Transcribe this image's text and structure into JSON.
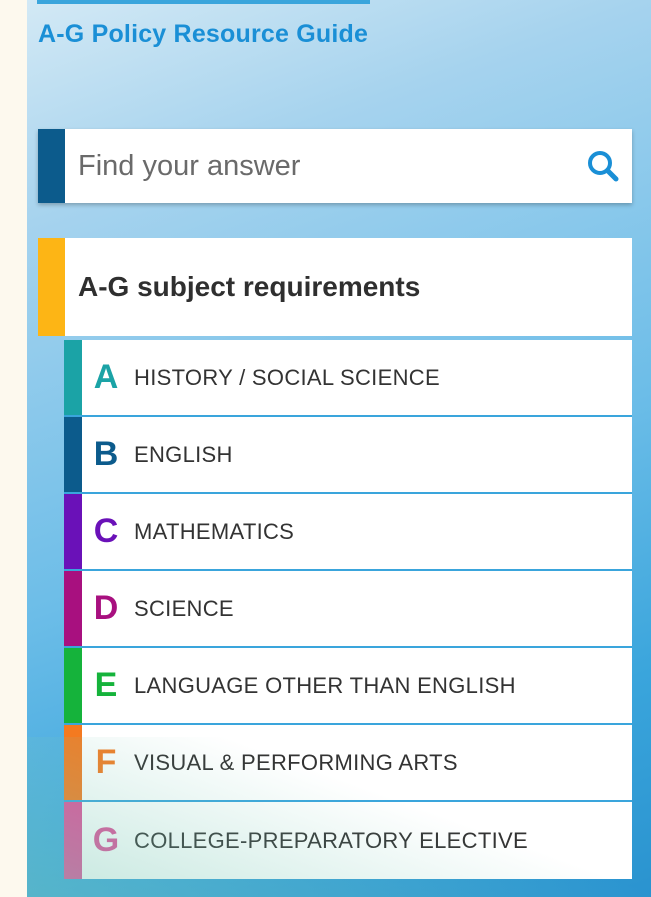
{
  "sidebar": {
    "title": "A-G Policy Resource Guide",
    "search": {
      "placeholder": "Find your answer",
      "value": "",
      "icon": "search-icon",
      "accent_color": "#0c5b8c"
    },
    "requirements_header": {
      "title": "A-G subject requirements",
      "accent_color": "#fdb515"
    },
    "subjects": [
      {
        "letter": "A",
        "name": "HISTORY / SOCIAL SCIENCE",
        "color": "#1ba3a6"
      },
      {
        "letter": "B",
        "name": "ENGLISH",
        "color": "#0c5b8c"
      },
      {
        "letter": "C",
        "name": "MATHEMATICS",
        "color": "#6a11b8"
      },
      {
        "letter": "D",
        "name": "SCIENCE",
        "color": "#a8107f"
      },
      {
        "letter": "E",
        "name": "LANGUAGE OTHER THAN ENGLISH",
        "color": "#15b33b"
      },
      {
        "letter": "F",
        "name": "VISUAL & PERFORMING ARTS",
        "color": "#f47a20"
      },
      {
        "letter": "G",
        "name": "COLLEGE-PREPARATORY ELECTIVE",
        "color": "#e0509a"
      }
    ]
  }
}
